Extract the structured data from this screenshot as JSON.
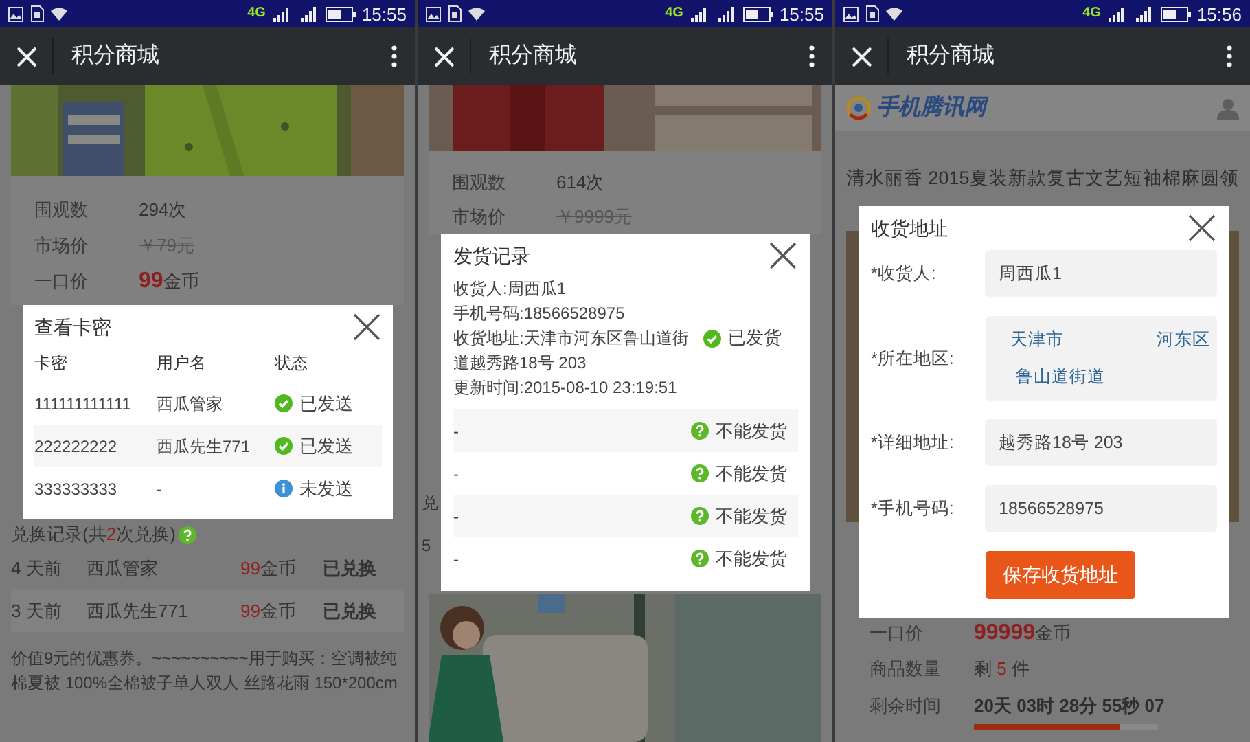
{
  "screens": [
    {
      "kind": "card_codes",
      "status_bar": {
        "network": "4G",
        "time": "15:55"
      },
      "header": {
        "title": "积分商城"
      },
      "stats": [
        {
          "label": "围观数",
          "kind": "plain",
          "value": "294次"
        },
        {
          "label": "市场价",
          "kind": "struck",
          "value": "￥79元"
        },
        {
          "label": "一口价",
          "kind": "price",
          "amount": "99",
          "unit": "金币"
        }
      ],
      "exchange_log": {
        "prefix": "兑换记录(共",
        "count": "2",
        "suffix": "次兑换)",
        "rows": [
          {
            "time": "4 天前",
            "user": "西瓜管家",
            "amount": "99",
            "unit": "金币",
            "status": "已兑换"
          },
          {
            "time": "3 天前",
            "user": "西瓜先生771",
            "amount": "99",
            "unit": "金币",
            "status": "已兑换"
          }
        ]
      },
      "description": "价值9元的优惠券。~~~~~~~~~~用于购买：空调被纯棉夏被 100%全棉被子单人双人 丝路花雨 150*200cm",
      "modal": {
        "title": "查看卡密",
        "columns": [
          "卡密",
          "用户名",
          "状态"
        ],
        "rows": [
          {
            "code": "111111111111",
            "user": "西瓜管家",
            "status": "已发送",
            "sent": true
          },
          {
            "code": "222222222",
            "user": "西瓜先生771",
            "status": "已发送",
            "sent": true
          },
          {
            "code": "333333333",
            "user": "-",
            "status": "未发送",
            "sent": false
          }
        ]
      }
    },
    {
      "kind": "delivery_record",
      "status_bar": {
        "network": "4G",
        "time": "15:55"
      },
      "header": {
        "title": "积分商城"
      },
      "stats": [
        {
          "label": "围观数",
          "kind": "plain",
          "value": "614次"
        },
        {
          "label": "市场价",
          "kind": "struck",
          "value": "￥9999元"
        }
      ],
      "peek_texts": [
        "兑",
        "5"
      ],
      "modal": {
        "title": "发货记录",
        "record": {
          "receiver": "收货人:周西瓜1",
          "phone": "手机号码:18566528975",
          "address": "收货地址:天津市河东区鲁山道街道越秀路18号 203",
          "updated": "更新时间:2015-08-10 23:19:51",
          "status": "已发货",
          "shipped": true
        },
        "rows": [
          {
            "text": "-",
            "status": "不能发货",
            "shipped": false
          },
          {
            "text": "-",
            "status": "不能发货",
            "shipped": false
          },
          {
            "text": "-",
            "status": "不能发货",
            "shipped": false
          },
          {
            "text": "-",
            "status": "不能发货",
            "shipped": false
          }
        ]
      }
    },
    {
      "kind": "address_form",
      "status_bar": {
        "network": "4G",
        "time": "15:56"
      },
      "header": {
        "title": "积分商城"
      },
      "site": {
        "name": "手机腾讯网"
      },
      "product_title": "清水丽香 2015夏装新款复古文艺短袖棉麻圆领",
      "stats": [
        {
          "label": "一口价",
          "kind": "price",
          "amount": "99999",
          "unit": "金币"
        },
        {
          "label": "商品数量",
          "kind": "stock",
          "prefix": "剩 ",
          "count": "5",
          "suffix": " 件"
        },
        {
          "label": "剩余时间",
          "kind": "countdown",
          "value": "20天 03时 28分 55秒 07",
          "level": 0.79
        }
      ],
      "modal": {
        "title": "收货地址",
        "fields": [
          {
            "label": "*收货人:",
            "kind": "input",
            "value": "周西瓜1"
          },
          {
            "label": "*所在地区:",
            "kind": "region",
            "options": [
              "天津市",
              "河东区",
              "鲁山道街道"
            ]
          },
          {
            "label": "*详细地址:",
            "kind": "input",
            "value": "越秀路18号 203"
          },
          {
            "label": "*手机号码:",
            "kind": "input",
            "value": "18566528975"
          }
        ],
        "button": "保存收货地址"
      }
    }
  ]
}
